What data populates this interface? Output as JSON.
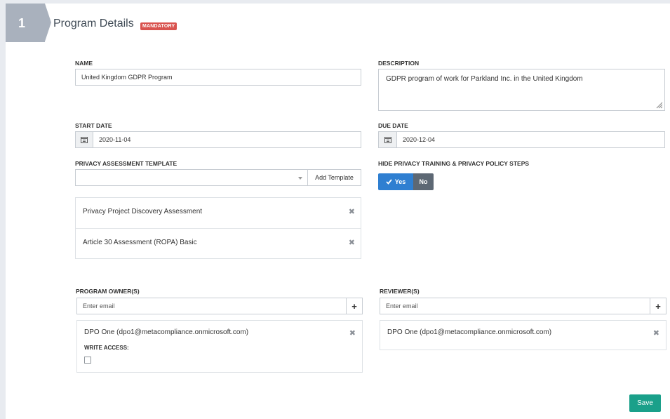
{
  "step": {
    "number": "1"
  },
  "header": {
    "title": "Program Details",
    "badge": "MANDATORY"
  },
  "name": {
    "label": "NAME",
    "value": "United Kingdom GDPR Program"
  },
  "description": {
    "label": "DESCRIPTION",
    "value": "GDPR program of work for Parkland Inc. in the United Kingdom"
  },
  "start_date": {
    "label": "START DATE",
    "value": "2020-11-04",
    "icon": "calendar-icon"
  },
  "due_date": {
    "label": "DUE DATE",
    "value": "2020-12-04",
    "icon": "calendar-icon"
  },
  "template": {
    "label": "PRIVACY ASSESSMENT TEMPLATE",
    "selected": "",
    "add_button": "Add Template",
    "items": [
      {
        "label": "Privacy Project Discovery Assessment"
      },
      {
        "label": "Article 30 Assessment (ROPA) Basic"
      }
    ]
  },
  "hide_steps": {
    "label": "HIDE PRIVACY TRAINING & PRIVACY POLICY STEPS",
    "yes": "Yes",
    "no": "No",
    "selected": "Yes"
  },
  "owners": {
    "label": "PROGRAM OWNER(S)",
    "placeholder": "Enter email",
    "add": "+",
    "items": [
      {
        "name": "DPO One (dpo1@metacompliance.onmicrosoft.com)",
        "write_access_label": "WRITE ACCESS:",
        "write_access": false
      }
    ]
  },
  "reviewers": {
    "label": "REVIEWER(S)",
    "placeholder": "Enter email",
    "add": "+",
    "items": [
      {
        "name": "DPO One (dpo1@metacompliance.onmicrosoft.com)"
      }
    ]
  },
  "actions": {
    "save": "Save",
    "remove": "✖"
  },
  "colors": {
    "accent": "#2f7fd1",
    "save": "#1aa08a",
    "badge": "#d9534f",
    "step": "#a9b1bd"
  }
}
